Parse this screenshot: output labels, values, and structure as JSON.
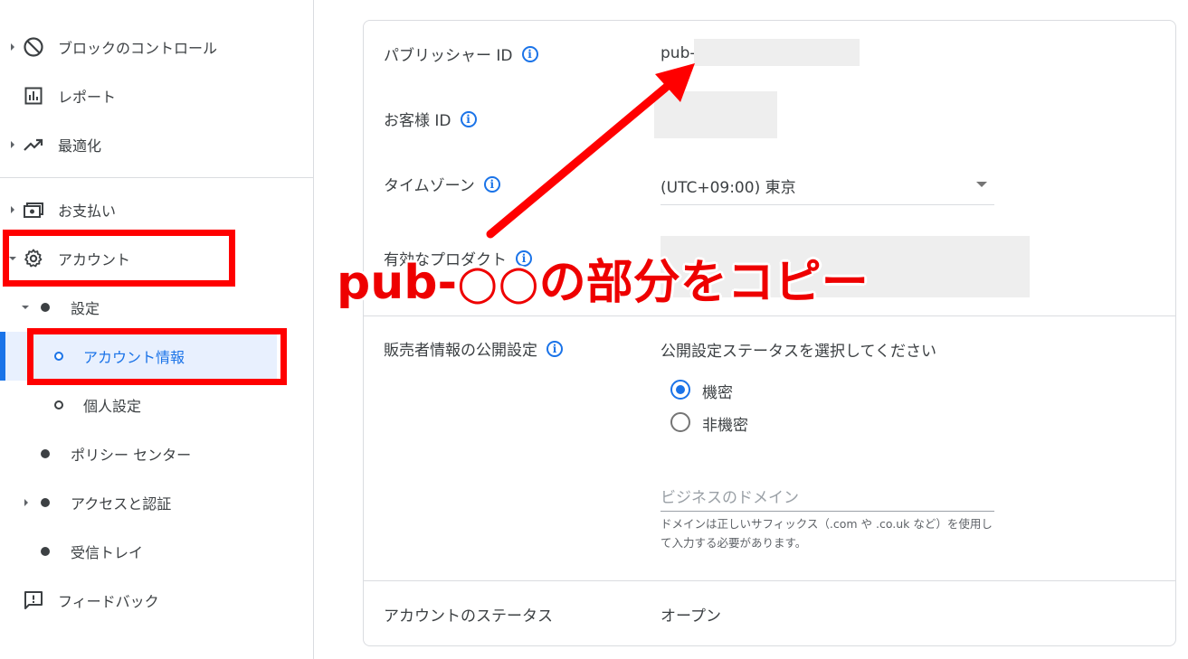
{
  "sidebar": {
    "items": [
      {
        "label": "ブロックのコントロール",
        "icon": "block-icon"
      },
      {
        "label": "レポート",
        "icon": "report-icon"
      },
      {
        "label": "最適化",
        "icon": "trending-up-icon"
      },
      {
        "label": "お支払い",
        "icon": "payments-icon"
      },
      {
        "label": "アカウント",
        "icon": "gear-icon"
      },
      {
        "label": "設定"
      },
      {
        "label": "アカウント情報"
      },
      {
        "label": "個人設定"
      },
      {
        "label": "ポリシー センター"
      },
      {
        "label": "アクセスと認証"
      },
      {
        "label": "受信トレイ"
      },
      {
        "label": "フィードバック",
        "icon": "feedback-icon"
      }
    ]
  },
  "account": {
    "publisher_id_label": "パブリッシャー ID",
    "publisher_id_value": "pub-",
    "customer_id_label": "お客様 ID",
    "timezone_label": "タイムゾーン",
    "timezone_value": "(UTC+09:00) 東京",
    "products_label": "有効なプロダクト",
    "seller_info_label": "販売者情報の公開設定",
    "status_prompt": "公開設定ステータスを選択してください",
    "radio_confidential": "機密",
    "radio_nonconfidential": "非機密",
    "domain_placeholder": "ビジネスのドメイン",
    "domain_hint": "ドメインは正しいサフィックス（.com や .co.uk など）を使用して入力する必要があります。",
    "account_status_label": "アカウントのステータス",
    "account_status_value": "オープン"
  },
  "annotation": {
    "text": "pub-○○の部分をコピー"
  },
  "colors": {
    "accent": "#1a73e8",
    "annotation_red": "#ff0000",
    "active_bg": "#e8f0fe"
  }
}
